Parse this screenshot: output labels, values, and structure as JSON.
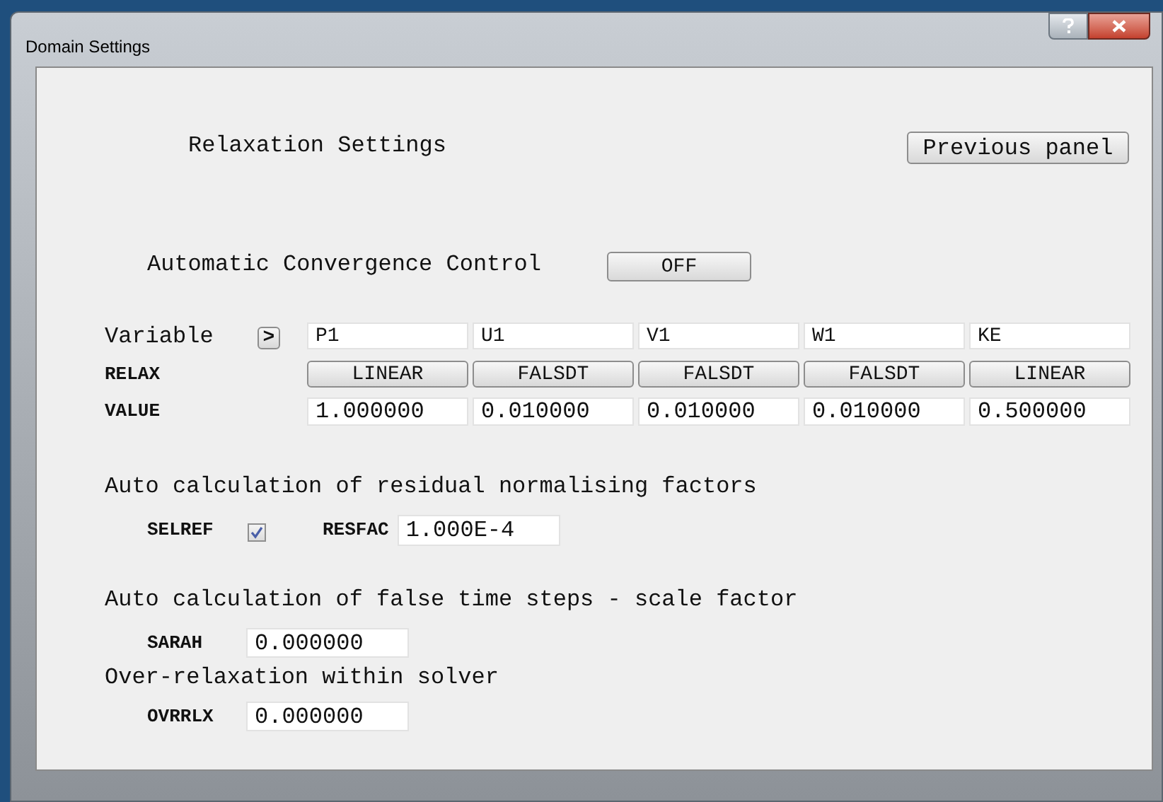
{
  "window": {
    "title": "Domain Settings"
  },
  "heading": "Relaxation Settings",
  "previous_button": "Previous panel",
  "convergence": {
    "label": "Automatic Convergence Control",
    "button": "OFF"
  },
  "variable_row": {
    "label": "Variable",
    "expand_button": ">",
    "cells": [
      "P1",
      "U1",
      "V1",
      "W1",
      "KE"
    ]
  },
  "relax_row": {
    "label": "RELAX",
    "buttons": [
      "LINEAR",
      "FALSDT",
      "FALSDT",
      "FALSDT",
      "LINEAR"
    ]
  },
  "value_row": {
    "label": "VALUE",
    "values": [
      "1.000000",
      "0.010000",
      "0.010000",
      "0.010000",
      "0.500000"
    ]
  },
  "residual": {
    "heading": "Auto calculation of residual normalising factors",
    "selref": {
      "label": "SELREF",
      "checked": true
    },
    "resfac": {
      "label": "RESFAC",
      "value": "1.000E-4"
    }
  },
  "false_time": {
    "heading": "Auto calculation of false time steps - scale factor",
    "sarah": {
      "label": "SARAH",
      "value": "0.000000"
    }
  },
  "over_relaxation": {
    "heading": "Over-relaxation within solver",
    "ovrrlx": {
      "label": "OVRRLX",
      "value": "0.000000"
    }
  }
}
